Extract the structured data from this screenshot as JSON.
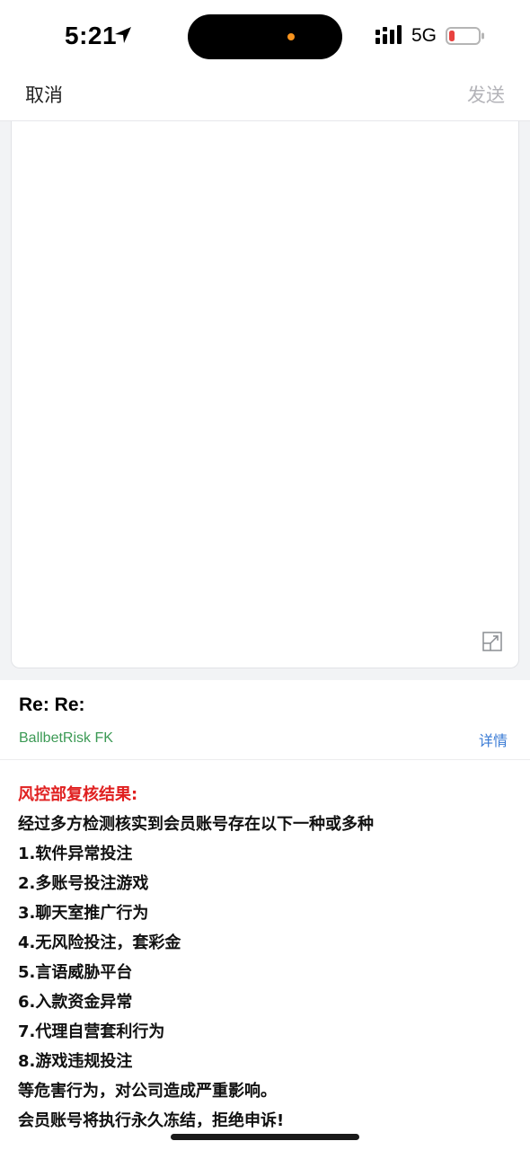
{
  "status_bar": {
    "time": "5:21",
    "network": "5G",
    "battery_color": "#e8423f"
  },
  "nav": {
    "cancel_label": "取消",
    "send_label": "发送"
  },
  "quote": {
    "subject": "Re: Re:",
    "sender": "BallbetRisk FK",
    "details_label": "详情"
  },
  "body": {
    "heading": "风控部复核结果:",
    "lines": [
      "经过多方检测核实到会员账号存在以下一种或多种",
      "1.软件异常投注",
      "2.多账号投注游戏",
      "3.聊天室推广行为",
      "4.无风险投注，套彩金",
      "5.言语威胁平台",
      "6.入款资金异常",
      "7.代理自营套利行为",
      "8.游戏违规投注",
      "等危害行为，对公司造成严重影响。",
      "会员账号将执行永久冻结，拒绝申诉!"
    ]
  }
}
